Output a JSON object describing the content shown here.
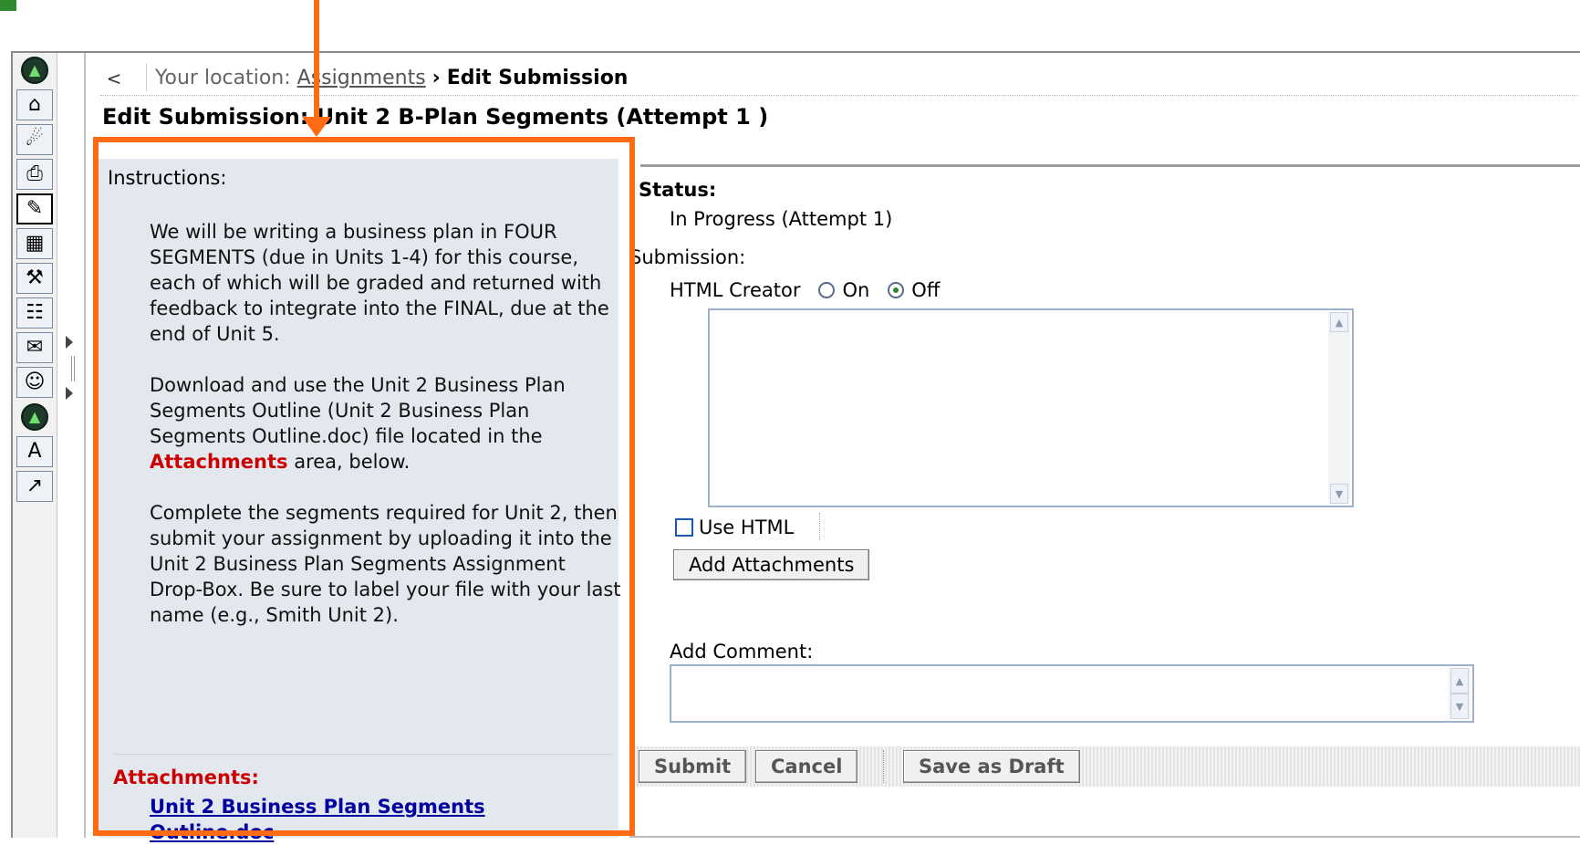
{
  "breadcrumb": {
    "back_symbol": "<",
    "prefix": "Your location:",
    "link": "Assignments",
    "separator": "›",
    "current": "Edit Submission"
  },
  "page_title": "Edit Submission: Unit 2 B-Plan Segments (Attempt 1 )",
  "instructions": {
    "label": "Instructions:",
    "p1": "We will be writing a business plan in FOUR SEGMENTS (due in Units 1-4) for this course, each of which will be graded and returned with feedback to integrate into the FINAL, due at the end of Unit 5.",
    "p2_before": "Download and use the Unit 2 Business Plan Segments Outline (Unit 2 Business Plan Segments Outline.doc) file located in the",
    "p2_highlight": "Attachments",
    "p2_after": "area, below.",
    "p3": "Complete the segments required for Unit 2, then submit your assignment by uploading it into the Unit 2 Business Plan Segments Assignment Drop-Box. Be sure to label your file with your last name (e.g., Smith Unit 2)."
  },
  "attachments": {
    "label": "Attachments:",
    "link_line1": "Unit 2 Business Plan Segments",
    "link_line2": "Outline.doc"
  },
  "status": {
    "label": "Status:",
    "value": "In Progress (Attempt 1)"
  },
  "submission": {
    "label": "Submission:",
    "html_creator_label": "HTML Creator",
    "radio_on": "On",
    "radio_off": "Off",
    "selected": "Off",
    "text_value": "",
    "use_html_label": "Use HTML",
    "use_html_checked": false,
    "add_attachments": "Add Attachments"
  },
  "comment": {
    "label": "Add Comment:",
    "value": ""
  },
  "actions": {
    "submit": "Submit",
    "cancel": "Cancel",
    "save_draft": "Save as Draft"
  },
  "toolbar_icons": [
    "collapse-up-icon",
    "home-icon",
    "satellite-icon",
    "assignments-icon",
    "edit-icon",
    "calendar-icon",
    "pushpin-icon",
    "documents-icon",
    "mail-add-icon",
    "roster-icon",
    "collapse-up-icon",
    "grade-icon",
    "chart-icon"
  ],
  "colors": {
    "annotation": "#ff6a13",
    "panel_bg": "#e3e7ee",
    "attachment_red": "#cc0000",
    "link_blue": "#0000a0"
  }
}
